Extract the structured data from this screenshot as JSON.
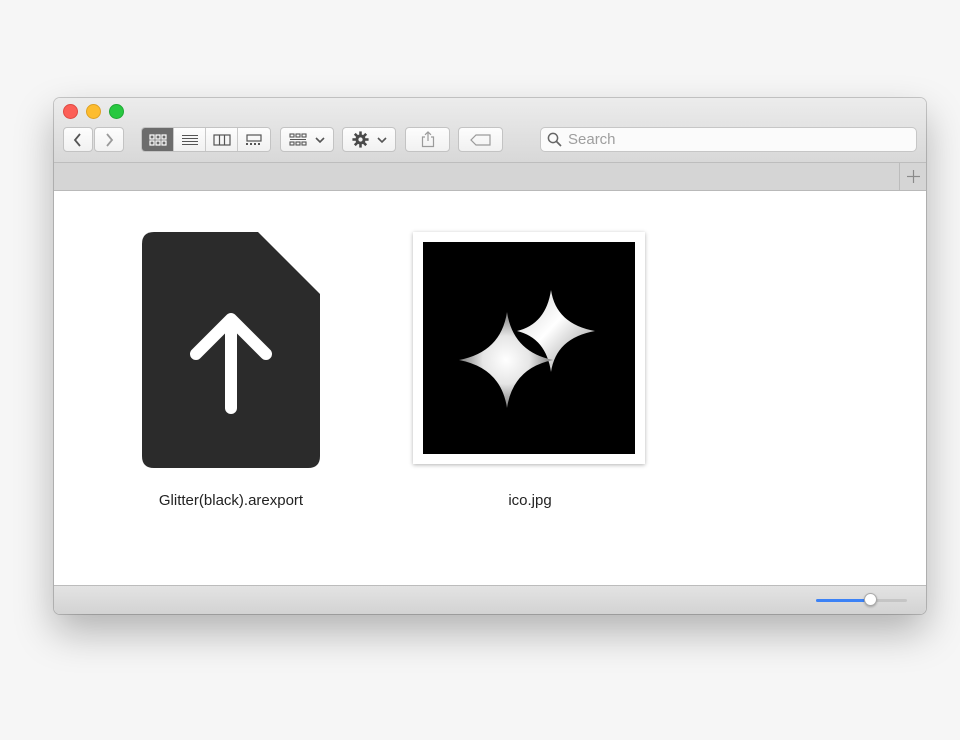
{
  "window": {
    "traffic_lights": [
      "close",
      "minimize",
      "maximize"
    ]
  },
  "toolbar": {
    "back_icon": "chevron-left-icon",
    "forward_icon": "chevron-right-icon",
    "view_modes": [
      "icon-view",
      "list-view",
      "column-view",
      "gallery-view"
    ],
    "active_view": "icon-view",
    "group_icon": "group-grid-icon",
    "action_icon": "gear-icon",
    "share_icon": "share-icon",
    "tag_icon": "tag-icon"
  },
  "search": {
    "placeholder": "Search",
    "value": ""
  },
  "tabbar": {
    "add_icon": "plus-icon"
  },
  "files": [
    {
      "name": "Glitter(black).arexport",
      "icon": "arexport-file-icon"
    },
    {
      "name": "ico.jpg",
      "icon": "image-thumbnail"
    }
  ],
  "status": {
    "icon_size_fraction": 0.6
  },
  "colors": {
    "slider_accent": "#3c82f6",
    "close": "#fc5f57",
    "minimize": "#fdbc2e",
    "maximize": "#27c840"
  }
}
